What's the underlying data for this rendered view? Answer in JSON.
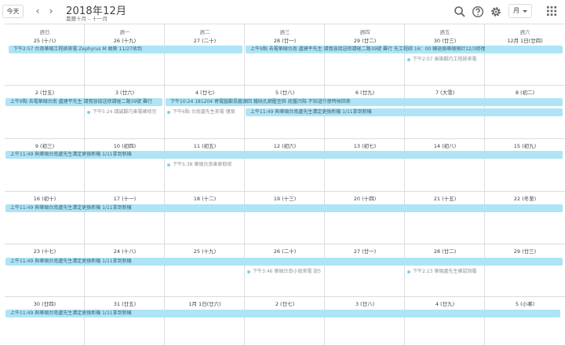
{
  "header": {
    "today_label": "今天",
    "prev_icon": "chevron-left-icon",
    "next_icon": "chevron-right-icon",
    "title": "2018年12月",
    "subtitle": "農曆十月 – 十一月",
    "view_label": "月"
  },
  "weekdays": [
    "週日",
    "週一",
    "週二",
    "週三",
    "週四",
    "週五",
    "週六"
  ],
  "weeks": [
    {
      "days": [
        "25 (十八)",
        "26 (十九)",
        "27 (二十)",
        "28 (廿一)",
        "29 (廿二)",
        "30 (廿三)",
        "12月 1日(廿四)"
      ],
      "bars": [
        {
          "text": "下午2:57 台南華碩工程師來電 Zephyrus M 敢衝 11/27收到",
          "start": 0,
          "end": 3,
          "row": 0,
          "left_arrow": true
        },
        {
          "text": "上午9點 去電華碩台南 盧建平先生 請寬容接送修請碰二路39號 難行 先工程師 16：00 轉退換華碩預計12/3修復",
          "start": 3,
          "end": 7,
          "row": 0
        }
      ],
      "dots": [
        {
          "text": "下午2:07 高雄觀巧工程師來電",
          "col": 5,
          "row": 1
        }
      ]
    },
    {
      "days": [
        "2 (廿五)",
        "3 (廿六)",
        "4 (廿七)",
        "5 (廿八)",
        "6 (廿九)",
        "7 (大雪)",
        "8 (初二)"
      ],
      "bars": [
        {
          "text": "上午9點 去電華碩台南 盧建平先生 請寬容接送修請碰二路39號 難行",
          "start": 0,
          "end": 2,
          "row": 0
        },
        {
          "text": "下午10:24 181204 寄電腦觀長龍源回 鐵絲孔網壓歪斜 底盤凹陷 不知道什麼時候回來",
          "start": 2,
          "end": 7,
          "row": 0
        },
        {
          "text": "上午11:49 與華碩台南盧先生溝定更換新機 1/11拿到新機",
          "start": 3,
          "end": 7,
          "row": 1
        }
      ],
      "dots": [
        {
          "text": "下午5:24 請誠觀巧東電確修完",
          "col": 1,
          "row": 1
        },
        {
          "text": "下午6點 台南盧先生來電 僅案",
          "col": 2,
          "row": 1
        }
      ]
    },
    {
      "days": [
        "9 (初三)",
        "10 (初四)",
        "11 (初五)",
        "12 (初六)",
        "13 (初七)",
        "14 (初八)",
        "15 (初九)"
      ],
      "bars": [
        {
          "text": "上午11:49 與華碩台南盧先生溝定更換新機 1/11拿到新機",
          "start": 0,
          "end": 7,
          "row": 0
        }
      ],
      "dots": [
        {
          "text": "下午5:38 華碩台南東索取修",
          "col": 2,
          "row": 1
        }
      ]
    },
    {
      "days": [
        "16 (初十)",
        "17 (十一)",
        "18 (十二)",
        "19 (十三)",
        "20 (十四)",
        "21 (十五)",
        "22 (冬至)"
      ],
      "bars": [
        {
          "text": "上午11:49 與華碩台南盧先生溝定更換新機 1/11拿到新機",
          "start": 0,
          "end": 7,
          "row": 0
        }
      ],
      "dots": []
    },
    {
      "days": [
        "23 (十七)",
        "24 (十八)",
        "25 (十九)",
        "26 (二十)",
        "27 (廿一)",
        "28 (廿二)",
        "29 (廿三)"
      ],
      "bars": [
        {
          "text": "上午11:49 與華碩台南盧先生溝定更換新機 1/11拿到新機",
          "start": 0,
          "end": 7,
          "row": 0
        }
      ],
      "dots": [
        {
          "text": "下午3:46 華碩台南小姐來電 說5",
          "col": 3,
          "row": 1
        },
        {
          "text": "下午2:23 華碩盧先生確認回覆",
          "col": 5,
          "row": 1
        }
      ]
    },
    {
      "days": [
        "30 (廿四)",
        "31 (廿五)",
        "1月 1日(廿六)",
        "2 (廿七)",
        "3 (廿八)",
        "4 (廿九)",
        "5 (小寒)"
      ],
      "bars": [
        {
          "text": "上午11:49 與華碩台南盧先生溝定更換新機 1/11拿到新機",
          "start": 0,
          "end": 7,
          "row": 0,
          "right_arrow": true
        }
      ],
      "dots": []
    }
  ],
  "colors": {
    "event_bar": "#aee4f6",
    "event_text": "#3c6676",
    "dot": "#7fcff0",
    "grid_line": "#dadce0"
  }
}
